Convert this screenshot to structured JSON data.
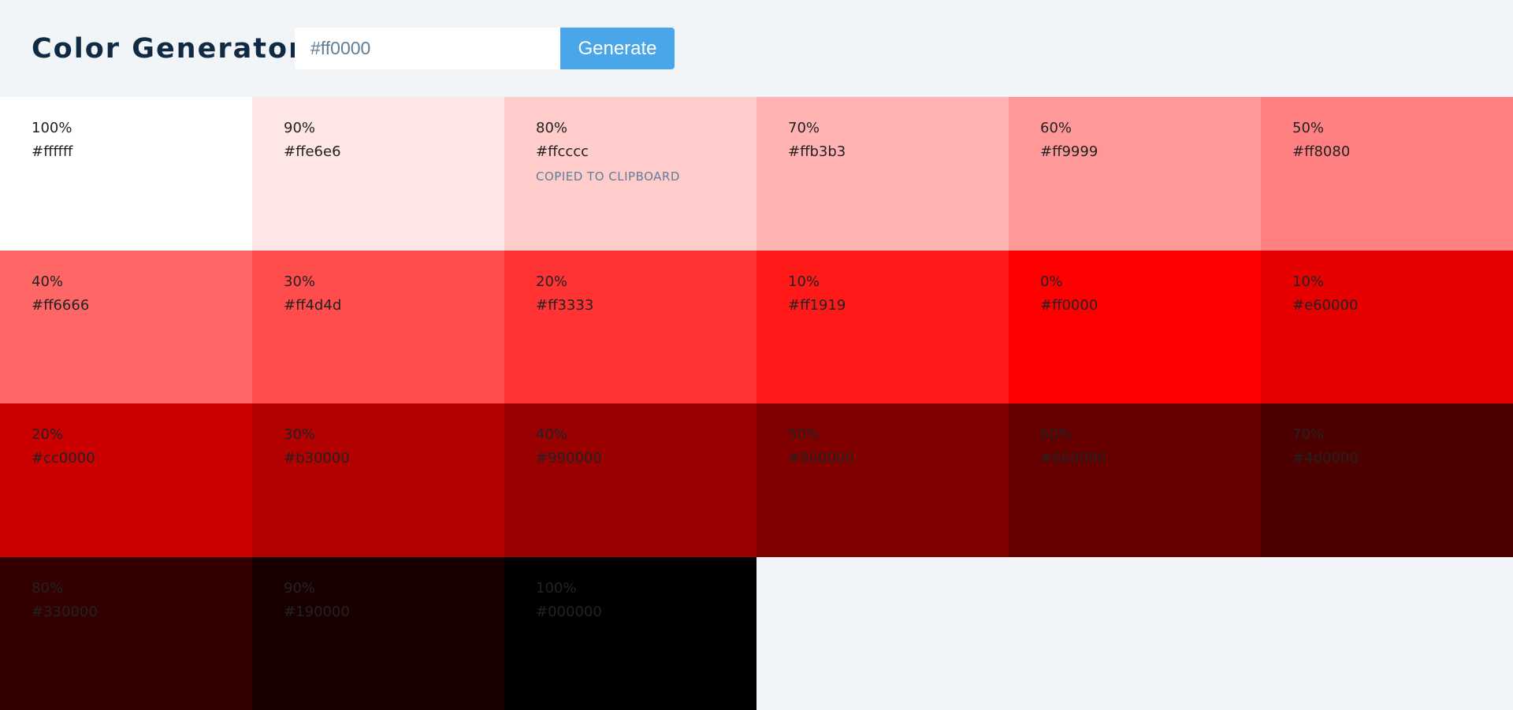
{
  "header": {
    "title": "Color Generator",
    "input_value": "#ff0000",
    "generate_label": "Generate"
  },
  "swatches": [
    {
      "percent": "100%",
      "hex": "#ffffff",
      "color": "#ffffff"
    },
    {
      "percent": "90%",
      "hex": "#ffe6e6",
      "color": "#ffe6e6"
    },
    {
      "percent": "80%",
      "hex": "#ffcccc",
      "color": "#ffcccc",
      "alert": "COPIED TO CLIPBOARD"
    },
    {
      "percent": "70%",
      "hex": "#ffb3b3",
      "color": "#ffb3b3"
    },
    {
      "percent": "60%",
      "hex": "#ff9999",
      "color": "#ff9999"
    },
    {
      "percent": "50%",
      "hex": "#ff8080",
      "color": "#ff8080"
    },
    {
      "percent": "40%",
      "hex": "#ff6666",
      "color": "#ff6666"
    },
    {
      "percent": "30%",
      "hex": "#ff4d4d",
      "color": "#ff4d4d"
    },
    {
      "percent": "20%",
      "hex": "#ff3333",
      "color": "#ff3333"
    },
    {
      "percent": "10%",
      "hex": "#ff1919",
      "color": "#ff1919"
    },
    {
      "percent": "0%",
      "hex": "#ff0000",
      "color": "#ff0000"
    },
    {
      "percent": "10%",
      "hex": "#e60000",
      "color": "#e60000"
    },
    {
      "percent": "20%",
      "hex": "#cc0000",
      "color": "#cc0000"
    },
    {
      "percent": "30%",
      "hex": "#b30000",
      "color": "#b30000"
    },
    {
      "percent": "40%",
      "hex": "#990000",
      "color": "#990000"
    },
    {
      "percent": "50%",
      "hex": "#800000",
      "color": "#800000"
    },
    {
      "percent": "60%",
      "hex": "#660000",
      "color": "#660000"
    },
    {
      "percent": "70%",
      "hex": "#4d0000",
      "color": "#4d0000"
    },
    {
      "percent": "80%",
      "hex": "#330000",
      "color": "#330000"
    },
    {
      "percent": "90%",
      "hex": "#190000",
      "color": "#190000"
    },
    {
      "percent": "100%",
      "hex": "#000000",
      "color": "#000000"
    }
  ]
}
